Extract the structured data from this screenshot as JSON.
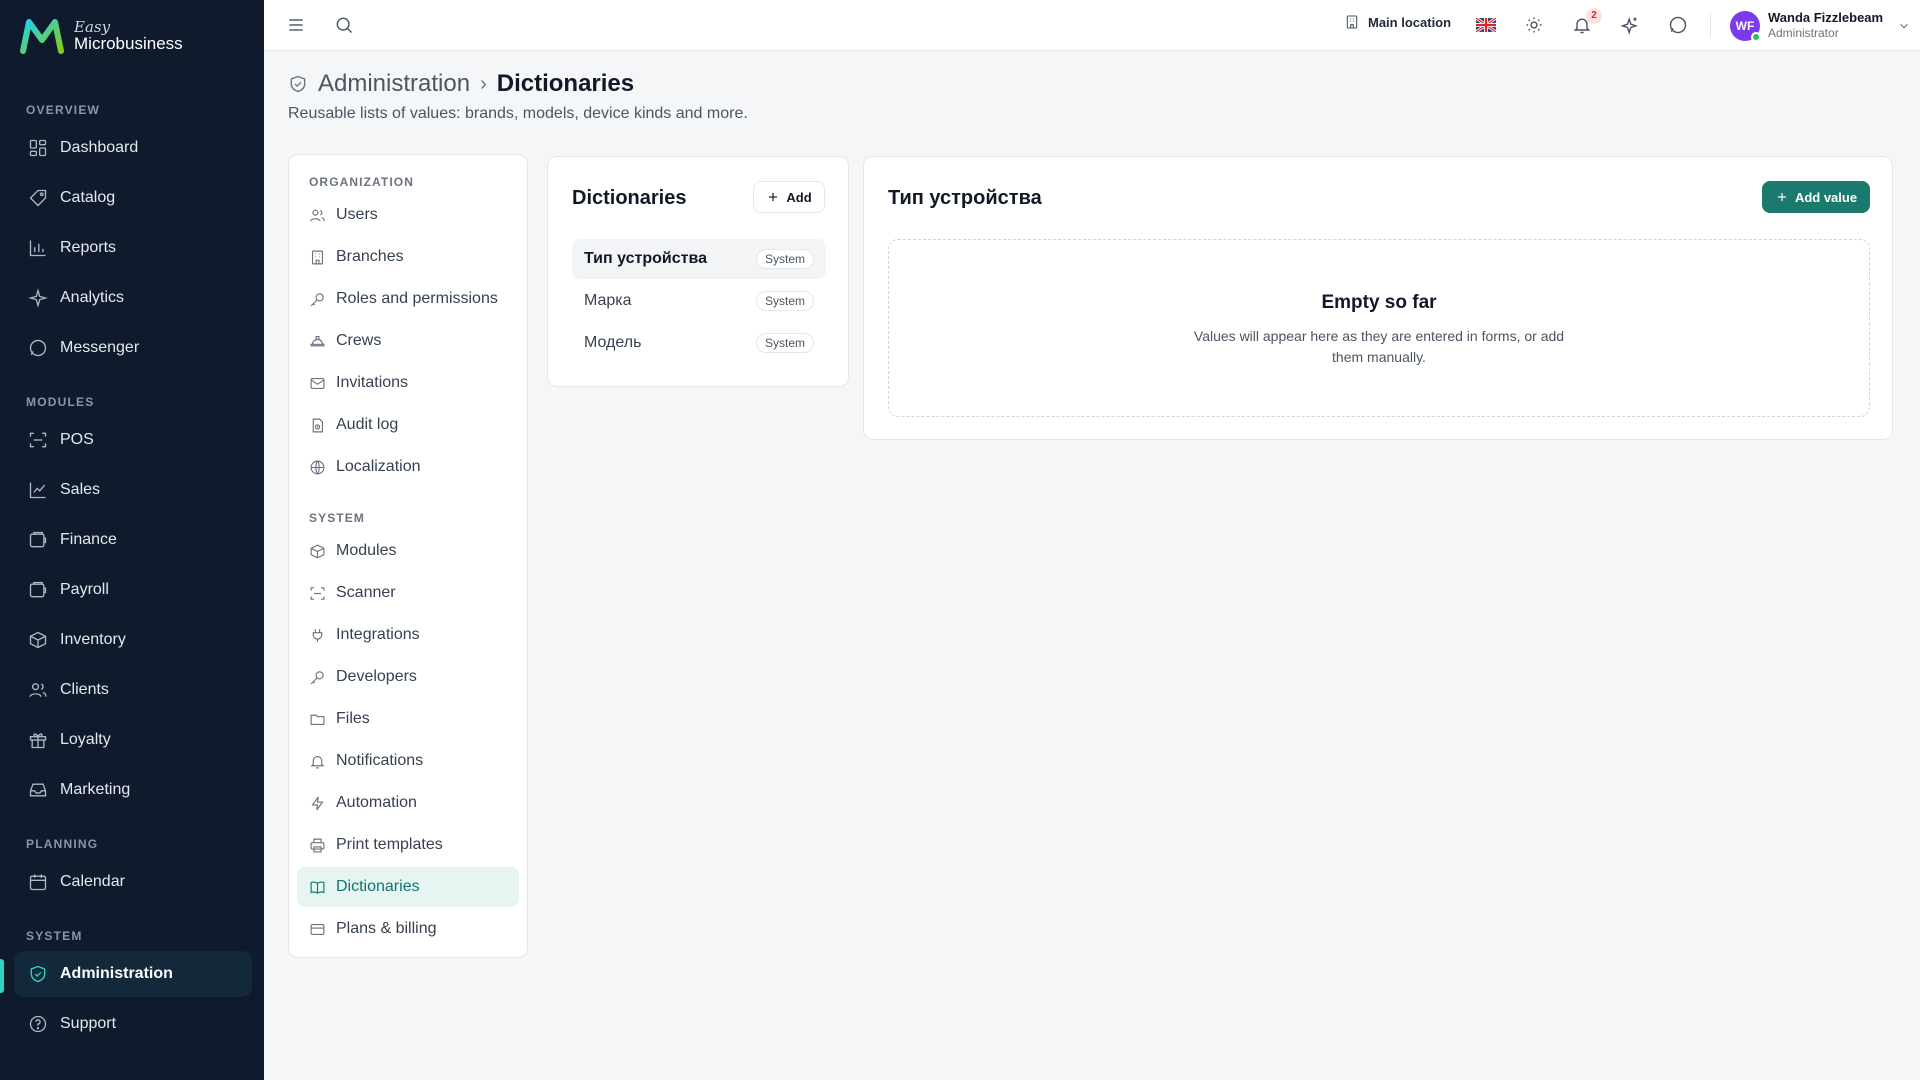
{
  "brand": {
    "easy": "Easy",
    "name": "Microbusiness"
  },
  "sidebar": {
    "groups": {
      "overview": "OVERVIEW",
      "modules": "MODULES",
      "planning": "PLANNING",
      "system": "SYSTEM"
    },
    "items": [
      {
        "label": "Dashboard",
        "icon": "dashboard-icon"
      },
      {
        "label": "Catalog",
        "icon": "tag-icon"
      },
      {
        "label": "Reports",
        "icon": "bar-chart-icon"
      },
      {
        "label": "Analytics",
        "icon": "sparkles-icon"
      },
      {
        "label": "Messenger",
        "icon": "chat-icon"
      },
      {
        "label": "POS",
        "icon": "scan-icon"
      },
      {
        "label": "Sales",
        "icon": "line-chart-icon"
      },
      {
        "label": "Finance",
        "icon": "wallet-icon"
      },
      {
        "label": "Payroll",
        "icon": "wallet-icon"
      },
      {
        "label": "Inventory",
        "icon": "box-icon"
      },
      {
        "label": "Clients",
        "icon": "users-icon"
      },
      {
        "label": "Loyalty",
        "icon": "gift-icon"
      },
      {
        "label": "Marketing",
        "icon": "inbox-icon"
      },
      {
        "label": "Calendar",
        "icon": "calendar-icon"
      },
      {
        "label": "Administration",
        "icon": "shield-check-icon"
      },
      {
        "label": "Support",
        "icon": "help-circle-icon"
      }
    ],
    "active": "Administration"
  },
  "topbar": {
    "location": "Main location",
    "notifications_count": "2",
    "user": {
      "initials": "WF",
      "name": "Wanda Fizzlebeam",
      "role": "Administrator"
    }
  },
  "header": {
    "breadcrumb_parent": "Administration",
    "breadcrumb_separator": "›",
    "title": "Dictionaries",
    "subtitle": "Reusable lists of values: brands, models, device kinds and more."
  },
  "settings_nav": {
    "organization_label": "ORGANIZATION",
    "system_label": "SYSTEM",
    "organization": [
      {
        "label": "Users",
        "icon": "users-icon"
      },
      {
        "label": "Branches",
        "icon": "building-icon"
      },
      {
        "label": "Roles and permissions",
        "icon": "key-icon"
      },
      {
        "label": "Crews",
        "icon": "hard-hat-icon"
      },
      {
        "label": "Invitations",
        "icon": "mail-icon"
      },
      {
        "label": "Audit log",
        "icon": "audit-icon"
      },
      {
        "label": "Localization",
        "icon": "globe-icon"
      }
    ],
    "system": [
      {
        "label": "Modules",
        "icon": "box-icon"
      },
      {
        "label": "Scanner",
        "icon": "scan-icon"
      },
      {
        "label": "Integrations",
        "icon": "plug-icon"
      },
      {
        "label": "Developers",
        "icon": "key-icon"
      },
      {
        "label": "Files",
        "icon": "folder-icon"
      },
      {
        "label": "Notifications",
        "icon": "bell-icon"
      },
      {
        "label": "Automation",
        "icon": "bolt-icon"
      },
      {
        "label": "Print templates",
        "icon": "printer-icon"
      },
      {
        "label": "Dictionaries",
        "icon": "book-icon"
      },
      {
        "label": "Plans & billing",
        "icon": "credit-card-icon"
      }
    ],
    "active": "Dictionaries"
  },
  "dictionaries": {
    "title": "Dictionaries",
    "add_label": "Add",
    "items": [
      {
        "name": "Тип устройства",
        "tag": "System"
      },
      {
        "name": "Марка",
        "tag": "System"
      },
      {
        "name": "Модель",
        "tag": "System"
      }
    ],
    "selected": "Тип устройства"
  },
  "detail": {
    "title": "Тип устройства",
    "add_value_label": "Add value",
    "empty_title": "Empty so far",
    "empty_text": "Values will appear here as they are entered in forms, or add them manually."
  },
  "colors": {
    "sidebar_bg": "#0f1b2d",
    "accent": "#1b7a6e",
    "active_teal": "#2dd4bf",
    "avatar": "#7c3aed"
  }
}
